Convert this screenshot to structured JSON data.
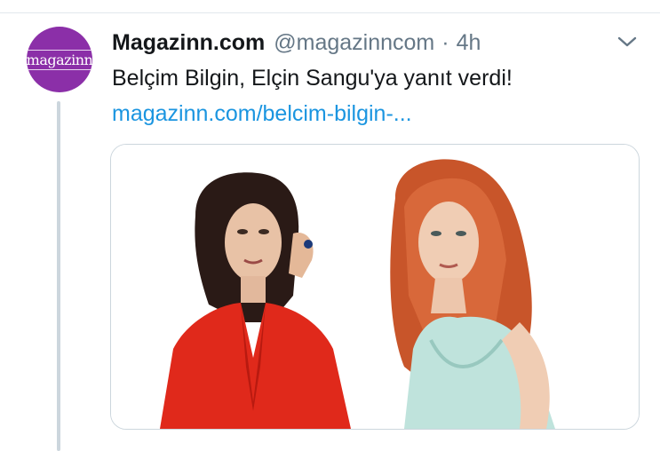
{
  "tweet": {
    "display_name": "Magazinn.com",
    "handle": "@magazinncom",
    "separator": "·",
    "time": "4h",
    "text": "Belçim Bilgin, Elçin Sangu'ya yanıt verdi!",
    "link": "magazinn.com/belcim-bilgin-..."
  },
  "avatar": {
    "logo_text": "magazinn",
    "bg_color": "#8b2fa8"
  },
  "icons": {
    "menu": "chevron-down-icon"
  },
  "colors": {
    "link": "#1b95e0",
    "muted": "#657786",
    "thread_line": "#ccd6dd"
  }
}
